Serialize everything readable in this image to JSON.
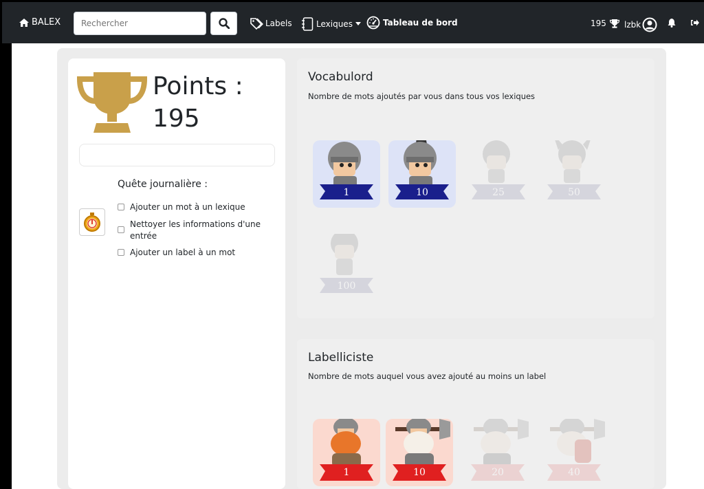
{
  "navbar": {
    "brand": "BALEX",
    "search_placeholder": "Rechercher",
    "labels": "Labels",
    "lexiques": "Lexiques",
    "dashboard": "Tableau de bord",
    "points": "195",
    "username": "lzbk"
  },
  "colors": {
    "navbar_bg": "#212529",
    "trophy_gold": "#c9a04a",
    "ribbon_blue": "#1a1f8c",
    "ribbon_red": "#e02020",
    "badge_blue_bg": "#dde3f7",
    "badge_red_bg": "#fbd9cf"
  },
  "score": {
    "title": "Points :",
    "value": "195"
  },
  "daily_quest": {
    "title": "Quête journalière :",
    "items": [
      "Ajouter un mot à un lexique",
      "Nettoyer les informations d'une entrée",
      "Ajouter un label à un mot"
    ]
  },
  "sections": [
    {
      "title": "Vocabulord",
      "description": "Nombre de mots ajoutés par vous dans tous vos lexiques",
      "badges": [
        {
          "value": "1",
          "earned": true
        },
        {
          "value": "10",
          "earned": true
        },
        {
          "value": "25",
          "earned": false
        },
        {
          "value": "50",
          "earned": false
        },
        {
          "value": "100",
          "earned": false
        }
      ]
    },
    {
      "title": "Labelliciste",
      "description": "Nombre de mots auquel vous avez ajouté au moins un label",
      "badges": [
        {
          "value": "1",
          "earned": true
        },
        {
          "value": "10",
          "earned": true
        },
        {
          "value": "20",
          "earned": false
        },
        {
          "value": "40",
          "earned": false
        }
      ]
    }
  ]
}
